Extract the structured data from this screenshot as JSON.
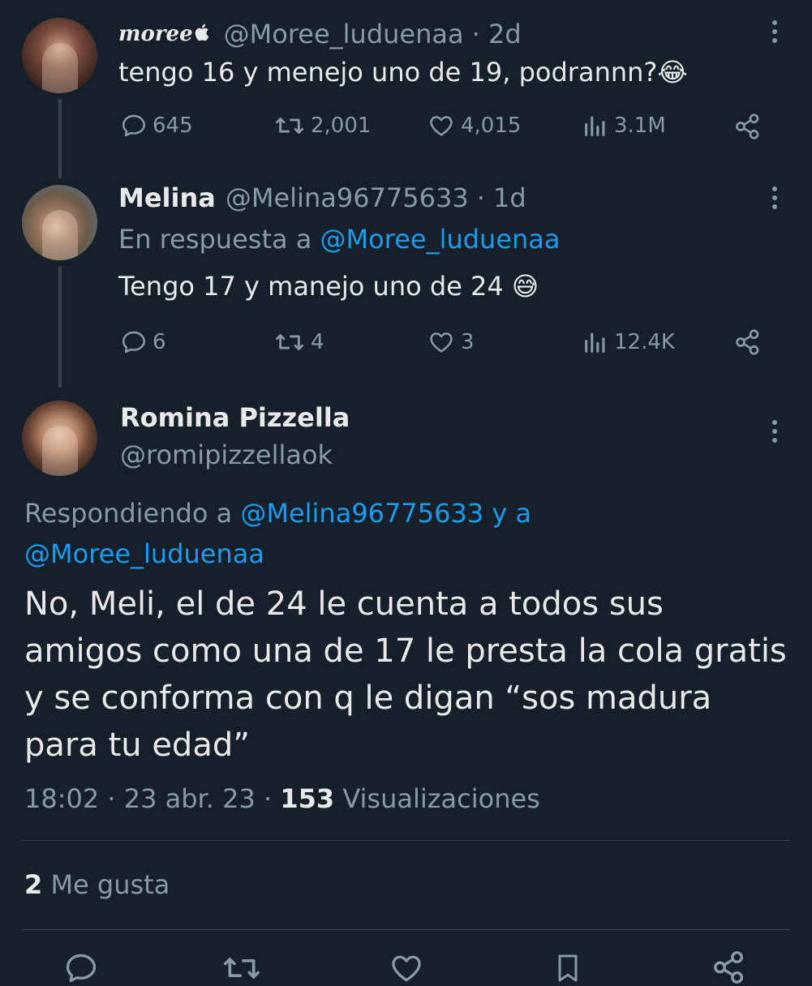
{
  "tweet1": {
    "display_name": "moree",
    "name_emoji": "",
    "handle": "@Moree_luduenaa",
    "time": "· 2d",
    "text": "tengo 16 y menejo uno de 19, podrannn?😂",
    "replies": "645",
    "retweets": "2,001",
    "likes": "4,015",
    "views": "3.1M"
  },
  "tweet2": {
    "display_name": "Melina",
    "handle": "@Melina96775633",
    "time": "· 1d",
    "reply_prefix": "En respuesta a",
    "reply_to": "@Moree_luduenaa",
    "text": "Tengo 17 y manejo uno de 24 😅",
    "replies": "6",
    "retweets": "4",
    "likes": "3",
    "views": "12.4K"
  },
  "main_tweet": {
    "display_name": "Romina Pizzella",
    "handle": "@romipizzellaok",
    "replying_prefix": "Respondiendo a",
    "replying_to_1": "@Melina96775633",
    "replying_joiner": "y a",
    "replying_to_2": "@Moree_luduenaa",
    "text_line_1": "No, Meli, el de 24 le cuenta a todos sus",
    "text_line_2": "amigos como una de 17 le presta la cola gratis",
    "text_line_3": "y se conforma con q le digan “sos madura",
    "text_line_4": "para tu edad”",
    "time": "18:02",
    "date": "23 abr. 23",
    "views_count": "153",
    "views_label": "Visualizaciones",
    "likes_count": "2",
    "likes_label": "Me gusta"
  },
  "icons": {
    "reply": "reply-icon",
    "retweet": "retweet-icon",
    "like": "heart-icon",
    "views": "views-icon",
    "share": "share-icon",
    "more": "more-icon"
  },
  "colors": {
    "background": "#15202b",
    "text": "#e7e9ea",
    "muted": "#8b98a5",
    "accent": "#1d9bf0",
    "divider": "#38444d"
  }
}
